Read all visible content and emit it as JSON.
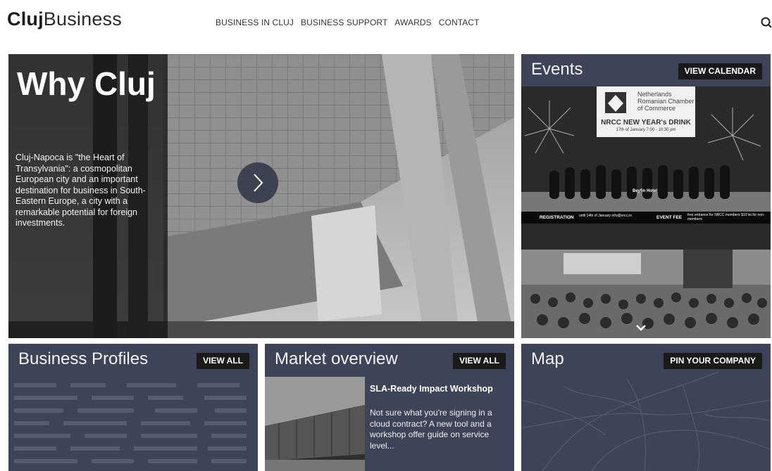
{
  "header": {
    "logo_bold": "Cluj",
    "logo_light": "Business",
    "nav": [
      "BUSINESS IN CLUJ",
      "BUSINESS SUPPORT",
      "AWARDS",
      "CONTACT"
    ]
  },
  "hero": {
    "title": "Why Cluj",
    "text": "Cluj-Napoca is \"the Heart of Transylvania\": a cosmopolitan European city and an important destination for business in South-Eastern Europe, a city with a remarkable potential for foreign investments."
  },
  "events": {
    "title": "Events",
    "button": "VIEW CALENDAR",
    "poster": {
      "org": "Netherlands Romanian Chamber of Commerce",
      "event": "NRCC NEW YEAR's DRINK",
      "date": "17th of January 7:00 - 10:30 pm",
      "venue": "Beyfin Hotel",
      "registration_label": "REGISTRATION",
      "registration_text": "until 14th of January info@nrcc.ro",
      "fee_label": "EVENT FEE",
      "fee_text": "free entrance for NRCC members $10 lei for non-members"
    }
  },
  "business_profiles": {
    "title": "Business Profiles",
    "button": "VIEW ALL"
  },
  "market": {
    "title": "Market overview",
    "button": "VIEW ALL",
    "article_title": "SLA-Ready Impact Workshop",
    "article_text": "Not sure what you're signing in a cloud contract? A new tool and a workshop offer guide on service level..."
  },
  "map": {
    "title": "Map",
    "button": "PIN YOUR COMPANY"
  },
  "icons": [
    "search-icon",
    "chevron-right-icon",
    "chevron-down-icon"
  ],
  "colors": {
    "panel": "#3d4457",
    "button": "#1a1a1a",
    "hero_overlay": "#141414"
  }
}
